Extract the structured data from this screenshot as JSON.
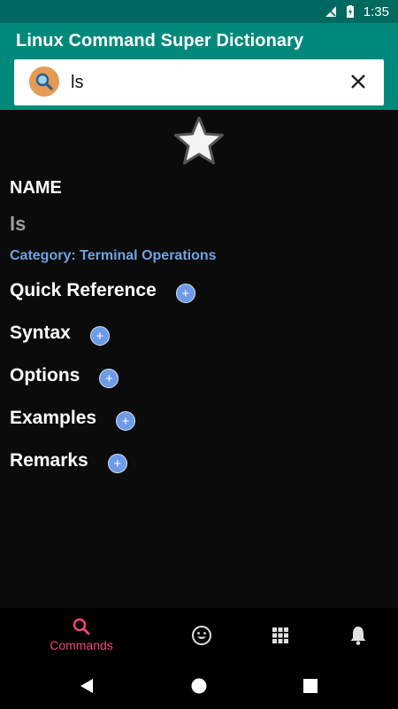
{
  "status": {
    "time": "1:35"
  },
  "app": {
    "title": "Linux Command Super Dictionary"
  },
  "search": {
    "value": "ls",
    "placeholder": ""
  },
  "detail": {
    "name_heading": "NAME",
    "command": "ls",
    "category": "Category: Terminal Operations",
    "sections": [
      "Quick Reference",
      "Syntax",
      "Options",
      "Examples",
      "Remarks"
    ],
    "expand_symbol": "+"
  },
  "bottom_nav": {
    "active_label": "Commands",
    "items": [
      "search-icon",
      "emoji-icon",
      "grid-icon",
      "bell-icon"
    ]
  },
  "colors": {
    "statusbar": "#00695f",
    "appbar": "#00897b",
    "accent": "#f0477a",
    "category": "#6fa3e0",
    "plus": "#6e9be6"
  }
}
